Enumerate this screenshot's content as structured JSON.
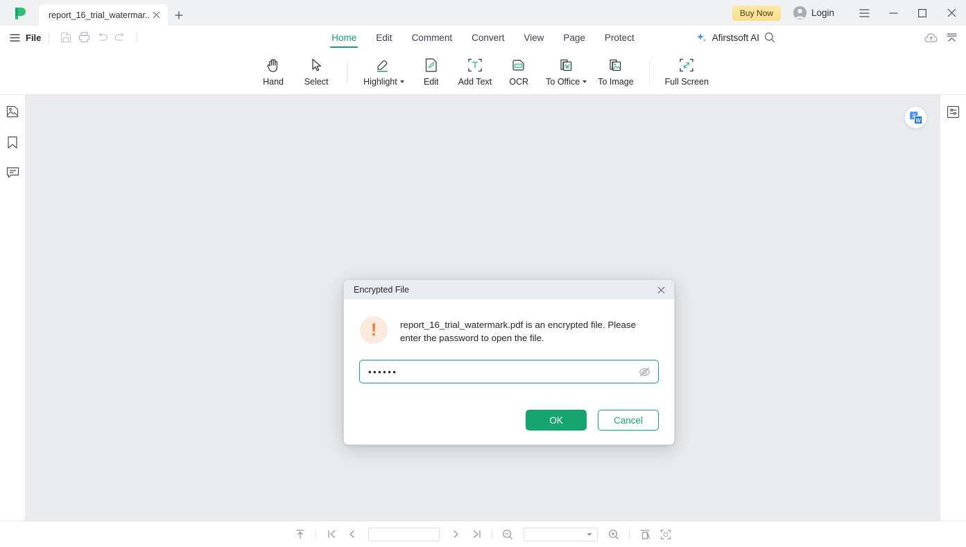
{
  "app": {
    "logo_name": "afirstsoft-logo",
    "window_controls": [
      "menu-icon",
      "minimize-icon",
      "maximize-icon",
      "close-icon"
    ]
  },
  "titlebar": {
    "tabs": [
      {
        "title": "report_16_trial_watermar...",
        "close_label": "✕",
        "active": true
      }
    ],
    "new_tab_label": "+",
    "buy_now_label": "Buy Now",
    "login_label": "Login"
  },
  "menubar": {
    "file_label": "File",
    "quick_access": [
      "save-icon",
      "print-icon",
      "undo-icon",
      "redo-icon"
    ],
    "ribbon_tabs": [
      {
        "label": "Home",
        "active": true
      },
      {
        "label": "Edit",
        "active": false
      },
      {
        "label": "Comment",
        "active": false
      },
      {
        "label": "Convert",
        "active": false
      },
      {
        "label": "View",
        "active": false
      },
      {
        "label": "Page",
        "active": false
      },
      {
        "label": "Protect",
        "active": false
      }
    ],
    "ai_label": "Afirstsoft AI",
    "search_icon": "search-icon",
    "cloud_icon": "cloud-upload-icon",
    "collapse_icon": "collapse-ribbon-icon"
  },
  "ribbon": {
    "items": [
      {
        "label": "Hand",
        "icon": "hand-icon",
        "dropdown": false
      },
      {
        "label": "Select",
        "icon": "cursor-icon",
        "dropdown": false
      },
      {
        "label": "Highlight",
        "icon": "highlighter-icon",
        "dropdown": true
      },
      {
        "label": "Edit",
        "icon": "edit-page-icon",
        "dropdown": false
      },
      {
        "label": "Add Text",
        "icon": "add-text-icon",
        "dropdown": false
      },
      {
        "label": "OCR",
        "icon": "ocr-icon",
        "dropdown": false
      },
      {
        "label": "To Office",
        "icon": "to-office-icon",
        "dropdown": true
      },
      {
        "label": "To Image",
        "icon": "to-image-icon",
        "dropdown": false
      },
      {
        "label": "Full Screen",
        "icon": "full-screen-icon",
        "dropdown": false
      }
    ]
  },
  "left_rail": {
    "items": [
      {
        "icon": "thumbnails-icon"
      },
      {
        "icon": "bookmark-icon"
      },
      {
        "icon": "comment-icon"
      }
    ]
  },
  "right_rail": {
    "items": [
      {
        "icon": "properties-panel-icon"
      }
    ]
  },
  "document": {
    "translate_fab_icon": "translate-icon"
  },
  "dialog": {
    "title": "Encrypted File",
    "close_label": "✕",
    "warning_icon": "warning-exclamation-icon",
    "message": "report_16_trial_watermark.pdf is an encrypted file. Please enter the password to open the file.",
    "password_value": "••••••",
    "password_placeholder": "",
    "toggle_visibility_icon": "eye-off-icon",
    "ok_label": "OK",
    "cancel_label": "Cancel"
  },
  "bottombar": {
    "scroll_top_icon": "scroll-to-top-icon",
    "first_page_icon": "first-page-icon",
    "prev_page_icon": "prev-page-icon",
    "page_value": "",
    "next_page_icon": "next-page-icon",
    "last_page_icon": "last-page-icon",
    "zoom_out_icon": "zoom-out-icon",
    "zoom_value": "",
    "zoom_in_icon": "zoom-in-icon",
    "fit_width_icon": "fit-width-icon",
    "fit_page_icon": "fit-page-icon"
  },
  "colors": {
    "accent_green": "#16a56f",
    "buy_now_amber": "#fcdd8a",
    "warning_orange": "#f07c2e",
    "ai_blue": "#3b8cf5"
  }
}
